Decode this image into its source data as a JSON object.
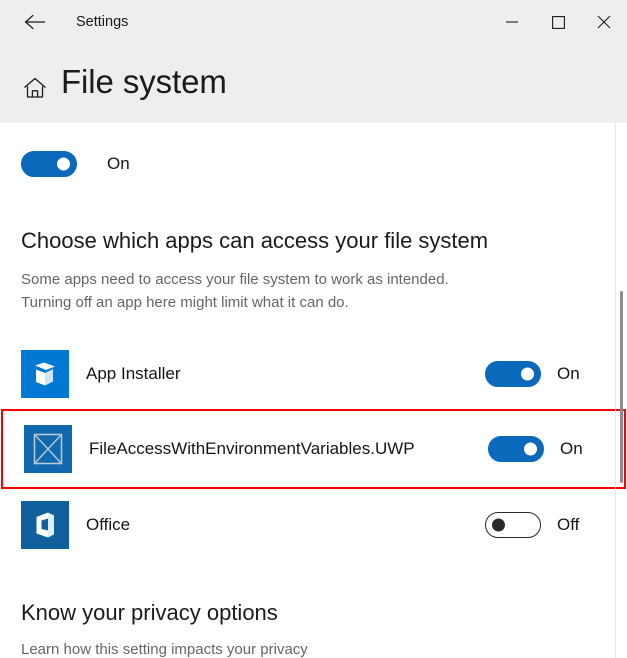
{
  "window": {
    "titlebar_text": "Settings",
    "back_icon": "back-arrow-icon",
    "minimize_label": "─",
    "maximize_label": "□",
    "close_label": "✕"
  },
  "header": {
    "home_icon": "home-icon",
    "page_title": "File system"
  },
  "master_toggle": {
    "state": "On",
    "label": "On"
  },
  "section": {
    "heading": "Choose which apps can access your file system",
    "description_line1": "Some apps need to access your file system to work as intended.",
    "description_line2": "Turning off an app here might limit what it can do."
  },
  "apps": [
    {
      "name": "App Installer",
      "icon": "app-installer-icon",
      "icon_bg": "#0078d4",
      "toggle_state": "On",
      "toggle_label": "On",
      "highlighted": false
    },
    {
      "name": "FileAccessWithEnvironmentVariables.UWP",
      "icon": "placeholder-image-icon",
      "icon_bg": "#1068ae",
      "toggle_state": "On",
      "toggle_label": "On",
      "highlighted": true
    },
    {
      "name": "Office",
      "icon": "office-icon",
      "icon_bg": "#10609e",
      "toggle_state": "Off",
      "toggle_label": "Off",
      "highlighted": false
    }
  ],
  "privacy": {
    "heading": "Know your privacy options",
    "link_text": "Learn how this setting impacts your privacy"
  },
  "colors": {
    "accent_blue": "#0a69ba",
    "highlight_red": "#ff0000",
    "header_gray": "#eeeeee",
    "text_primary": "#151515",
    "text_secondary": "#666666"
  }
}
